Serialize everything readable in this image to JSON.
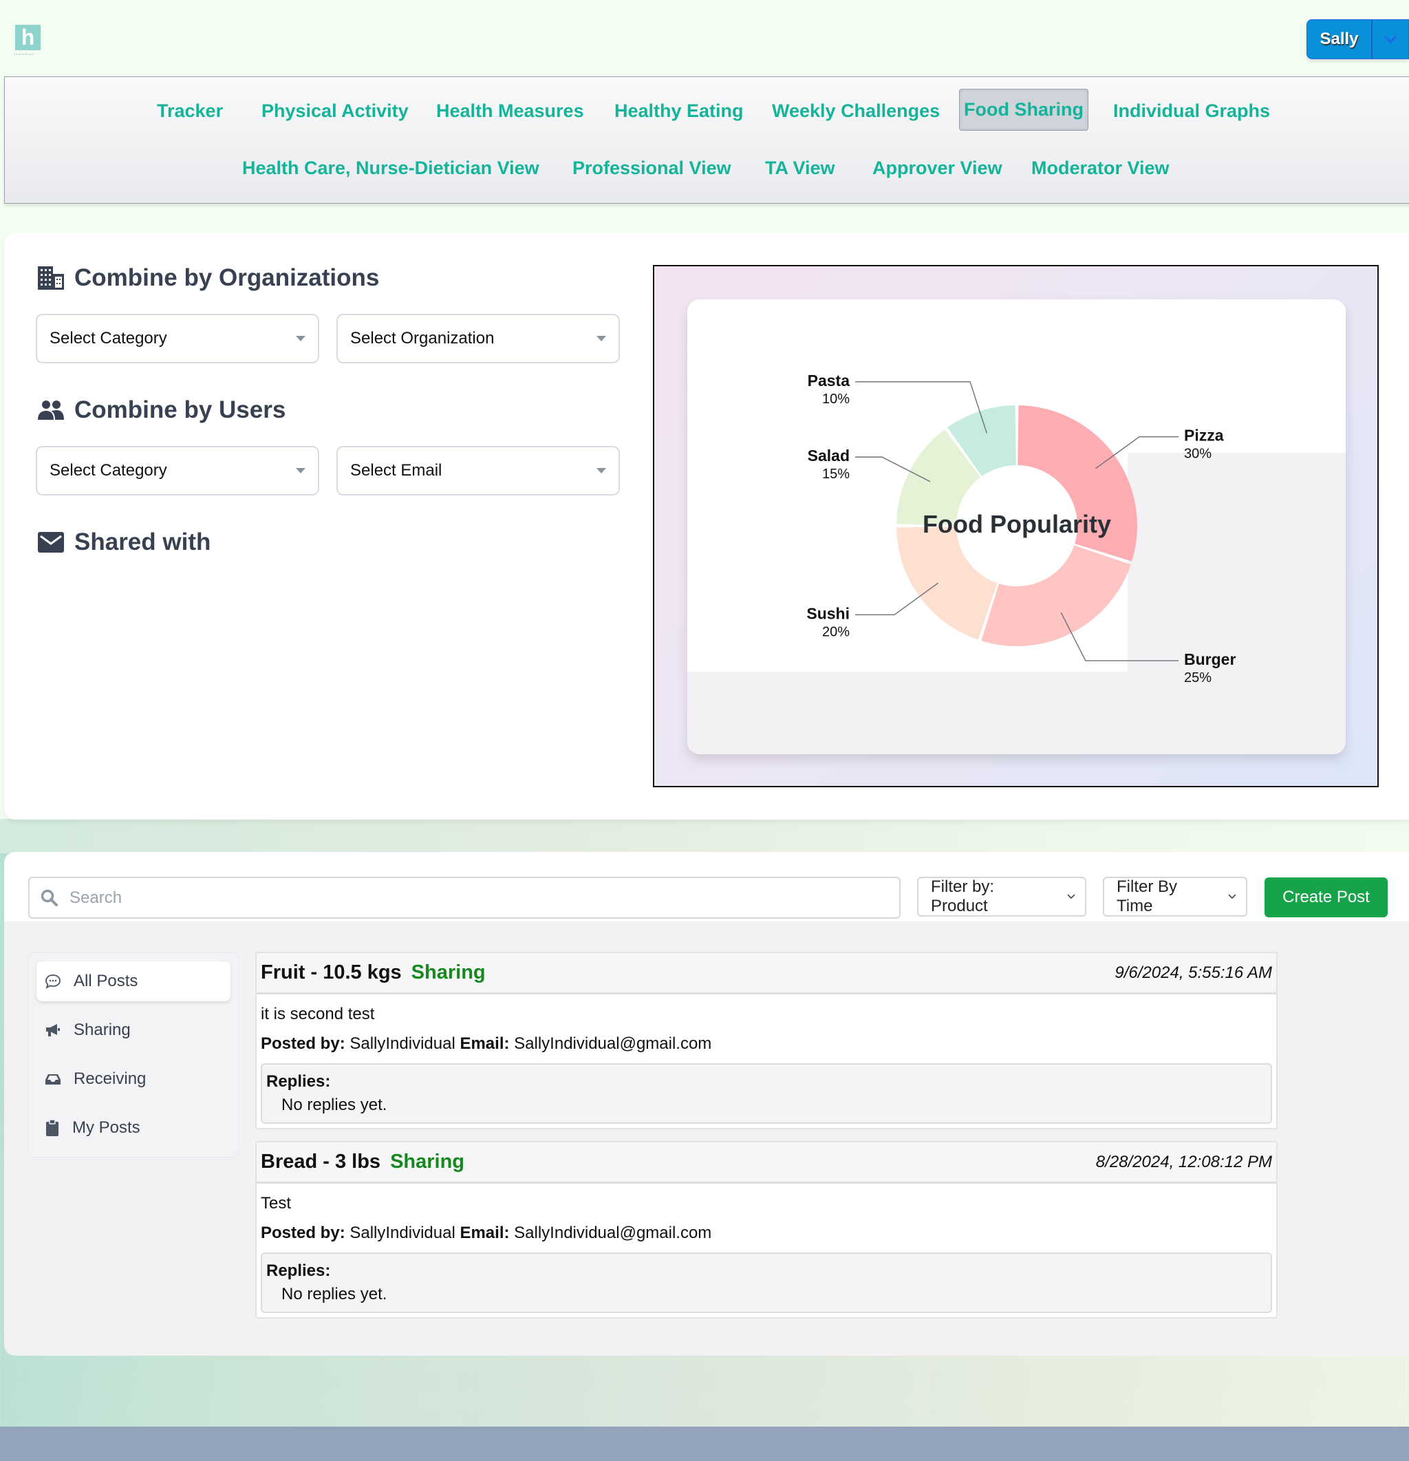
{
  "header": {
    "logo_letter": "h",
    "logo_caption": "healthenav",
    "user_name": "Sally",
    "user_menu_icon": "chevron-down-icon"
  },
  "nav": {
    "items": [
      {
        "label": "Tracker",
        "active": false
      },
      {
        "label": "Physical Activity",
        "active": false
      },
      {
        "label": "Health Measures",
        "active": false
      },
      {
        "label": "Healthy Eating",
        "active": false
      },
      {
        "label": "Weekly Challenges",
        "active": false
      },
      {
        "label": "Food Sharing",
        "active": true
      },
      {
        "label": "Individual Graphs",
        "active": false
      },
      {
        "label": "Health Care, Nurse-Dietician View",
        "active": false
      },
      {
        "label": "Professional View",
        "active": false
      },
      {
        "label": "TA View",
        "active": false
      },
      {
        "label": "Approver View",
        "active": false
      },
      {
        "label": "Moderator View",
        "active": false
      }
    ],
    "color": "#14b49a"
  },
  "combine": {
    "organizations": {
      "title": "Combine by Organizations",
      "icon": "building-icon",
      "category_placeholder": "Select Category",
      "organization_placeholder": "Select Organization"
    },
    "users": {
      "title": "Combine by Users",
      "icon": "users-icon",
      "category_placeholder": "Select Category",
      "email_placeholder": "Select Email"
    },
    "shared_with": {
      "title": "Shared with",
      "icon": "envelope-icon"
    }
  },
  "chart_data": {
    "type": "pie",
    "variant": "donut",
    "title": "Food Popularity",
    "categories": [
      "Pizza",
      "Burger",
      "Sushi",
      "Salad",
      "Pasta"
    ],
    "values": [
      30,
      25,
      20,
      15,
      10
    ],
    "labels": [
      "30%",
      "25%",
      "20%",
      "15%",
      "10%"
    ],
    "colors": [
      "#feadb3",
      "#fec5c2",
      "#fee0d1",
      "#e6f2d6",
      "#c6ece0"
    ],
    "start_angle": "12 o'clock",
    "direction": "clockwise",
    "legend": "none"
  },
  "feed": {
    "search_placeholder": "Search",
    "filter_product": "Filter by: Product",
    "filter_time": "Filter By Time",
    "create_post": "Create Post",
    "create_color": "#16a34a",
    "sidebar": [
      {
        "label": "All Posts",
        "icon": "chat-bubble-icon",
        "active": true
      },
      {
        "label": "Sharing",
        "icon": "megaphone-icon",
        "active": false
      },
      {
        "label": "Receiving",
        "icon": "inbox-icon",
        "active": false
      },
      {
        "label": "My Posts",
        "icon": "clipboard-icon",
        "active": false
      }
    ],
    "posts": [
      {
        "title": "Fruit - 10.5 kgs",
        "status": "Sharing",
        "date": "9/6/2024, 5:55:16 AM",
        "description": "it is second test",
        "posted_by_label": "Posted by:",
        "posted_by": "SallyIndividual",
        "email_label": "Email:",
        "email": "SallyIndividual@gmail.com",
        "replies_label": "Replies:",
        "replies_text": "No replies yet."
      },
      {
        "title": "Bread - 3 lbs",
        "status": "Sharing",
        "date": "8/28/2024, 12:08:12 PM",
        "description": "Test",
        "posted_by_label": "Posted by:",
        "posted_by": "SallyIndividual",
        "email_label": "Email:",
        "email": "SallyIndividual@gmail.com",
        "replies_label": "Replies:",
        "replies_text": "No replies yet."
      }
    ]
  }
}
